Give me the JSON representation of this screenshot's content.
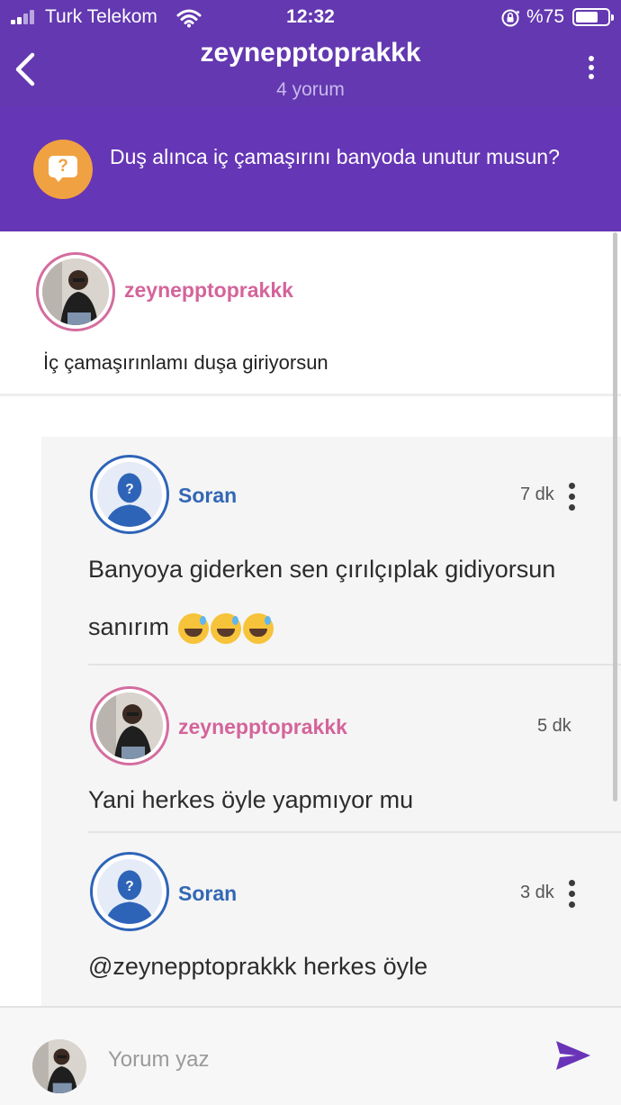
{
  "status_bar": {
    "carrier": "Turk Telekom",
    "time": "12:32",
    "battery": "%75",
    "battery_level": 0.75
  },
  "header": {
    "title": "zeynepptoprakkk",
    "subtitle": "4 yorum"
  },
  "question": {
    "icon": "question-bubble-icon",
    "text": "Duş alınca iç çamaşırını banyoda unutur musun?"
  },
  "post": {
    "author": "zeynepptoprakkk",
    "text": "İç çamaşırınlamı duşa giriyorsun"
  },
  "comments": [
    {
      "author": "Soran",
      "time": "7 dk",
      "text": "Banyoya giderken sen çırılçıplak gidiyorsun sanırım",
      "emojis": [
        "😅",
        "😅",
        "😅"
      ]
    },
    {
      "author": "zeynepptoprakkk",
      "time": "5 dk",
      "text": "Yani herkes öyle yapmıyor mu"
    },
    {
      "author": "Soran",
      "time": "3 dk",
      "text": "@zeynepptoprakkk herkes öyle"
    }
  ],
  "composer": {
    "placeholder": "Yorum yaz"
  },
  "colors": {
    "header_bg": "#6338b0",
    "question_bg": "#6536b5",
    "question_badge": "#f0a142",
    "author_pink": "#d4649b",
    "author_blue": "#3267b5",
    "send_icon": "#6a34b8"
  }
}
